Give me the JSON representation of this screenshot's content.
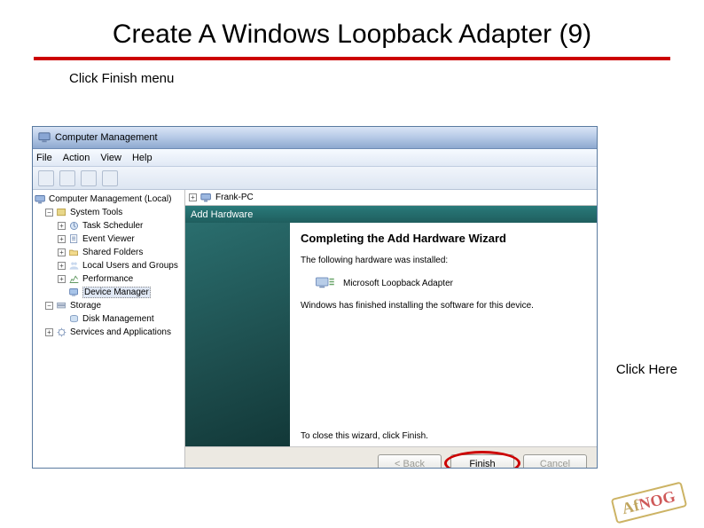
{
  "slide": {
    "title": "Create A Windows Loopback Adapter (9)",
    "instruction": "Click Finish menu",
    "click_here": "Click Here"
  },
  "window": {
    "title": "Computer Management",
    "menus": [
      "File",
      "Action",
      "View",
      "Help"
    ]
  },
  "tree": {
    "root": "Computer Management (Local)",
    "system_tools": "System Tools",
    "items": [
      "Task Scheduler",
      "Event Viewer",
      "Shared Folders",
      "Local Users and Groups",
      "Performance",
      "Device Manager"
    ],
    "storage": "Storage",
    "disk_mgmt": "Disk Management",
    "services": "Services and Applications"
  },
  "right": {
    "pc_name": "Frank-PC"
  },
  "wizard": {
    "add_hw": "Add Hardware",
    "heading": "Completing the Add Hardware Wizard",
    "installed_text": "The following hardware was installed:",
    "device": "Microsoft Loopback Adapter",
    "done_text": "Windows has finished installing the software for this device.",
    "close_text": "To close this wizard, click Finish.",
    "buttons": {
      "back": "< Back",
      "finish": "Finish",
      "cancel": "Cancel"
    }
  },
  "stamp": {
    "af": "Af",
    "nog": "NOG"
  }
}
